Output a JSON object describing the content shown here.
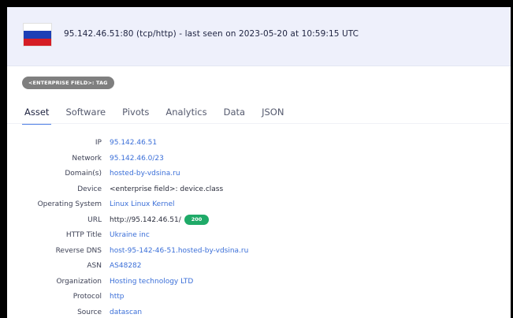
{
  "header": {
    "title": "95.142.46.51:80 (tcp/http) - last seen on 2023-05-20 at 10:59:15 UTC",
    "flag_colors": [
      "#ffffff",
      "#1c3fb6",
      "#d51d25"
    ],
    "flag_icon": "russia-flag-icon"
  },
  "tag": {
    "label": "<ENTERPRISE FIELD>: TAG"
  },
  "tabs": [
    {
      "label": "Asset",
      "active": true
    },
    {
      "label": "Software",
      "active": false
    },
    {
      "label": "Pivots",
      "active": false
    },
    {
      "label": "Analytics",
      "active": false
    },
    {
      "label": "Data",
      "active": false
    },
    {
      "label": "JSON",
      "active": false
    }
  ],
  "fields": [
    {
      "label": "IP",
      "value": "95.142.46.51",
      "link": true
    },
    {
      "label": "Network",
      "value": "95.142.46.0/23",
      "link": true
    },
    {
      "label": "Domain(s)",
      "value": "hosted-by-vdsina.ru",
      "link": true
    },
    {
      "label": "Device",
      "value": "<enterprise field>: device.class",
      "link": false
    },
    {
      "label": "Operating System",
      "value": "Linux Linux Kernel",
      "link": true
    },
    {
      "label": "URL",
      "value": "http://95.142.46.51/",
      "link": false,
      "badge": "200"
    },
    {
      "label": "HTTP Title",
      "value": "Ukraine inc",
      "link": true
    },
    {
      "label": "Reverse DNS",
      "value": "host-95-142-46-51.hosted-by-vdsina.ru",
      "link": true
    },
    {
      "label": "ASN",
      "value": "AS48282",
      "link": true
    },
    {
      "label": "Organization",
      "value": "Hosting technology LTD",
      "link": true
    },
    {
      "label": "Protocol",
      "value": "http",
      "link": true
    },
    {
      "label": "Source",
      "value": "datascan",
      "link": true
    }
  ],
  "colors": {
    "accent": "#4e7fe6",
    "link": "#3b6fd8",
    "status_ok": "#1faa68",
    "tag_bg": "#7f7f7f",
    "header_bg": "#eef0fb"
  }
}
